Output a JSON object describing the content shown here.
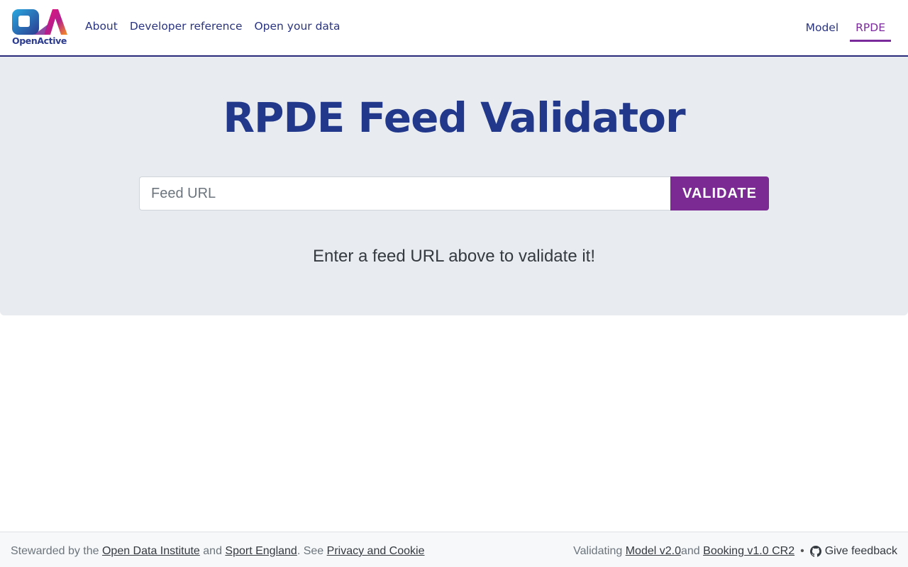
{
  "navbar": {
    "logo_text": "OpenActive",
    "left_links": [
      "About",
      "Developer reference",
      "Open your data"
    ],
    "right_links": [
      "Model",
      "RPDE"
    ],
    "active_link": "RPDE"
  },
  "hero": {
    "title": "RPDE Feed Validator",
    "input_placeholder": "Feed URL",
    "input_value": "",
    "button_label": "VALIDATE",
    "hint": "Enter a feed URL above to validate it!"
  },
  "footer": {
    "stewarded_prefix": "Stewarded by the ",
    "odi_link": "Open Data Institute",
    "and_1": " and ",
    "sport_england_link": "Sport England",
    "see_text": ". See ",
    "privacy_link": "Privacy and Cookie",
    "validating_prefix": "Validating ",
    "model_link": "Model v2.0",
    "and_2": " and ",
    "booking_link": "Booking v1.0 CR2",
    "bullet": "•",
    "feedback_link": "Give feedback",
    "feedback_icon": "github-icon"
  },
  "colors": {
    "brand_navy": "#22388a",
    "accent_purple": "#7b2a94",
    "hero_bg": "#e8ebef",
    "footer_bg": "#f7f8f9"
  }
}
